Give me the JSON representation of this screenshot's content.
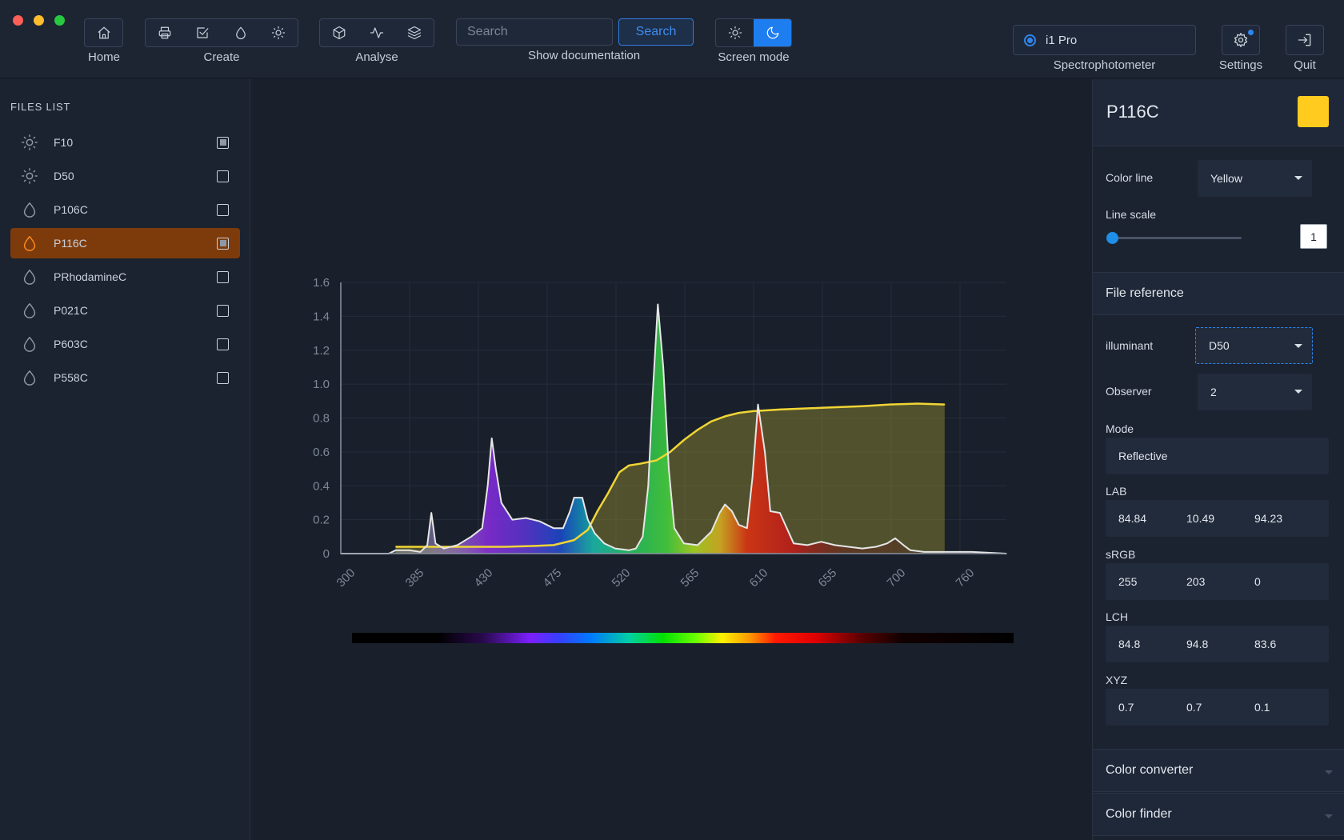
{
  "toolbar": {
    "home_label": "Home",
    "create_label": "Create",
    "analyse_label": "Analyse",
    "search_placeholder": "Search",
    "search_button": "Search",
    "docs_label": "Show documentation",
    "screen_mode_label": "Screen mode",
    "screen_mode_active": "dark",
    "spectro_device": "i1 Pro",
    "spectro_label": "Spectrophotometer",
    "settings_label": "Settings",
    "quit_label": "Quit"
  },
  "files": {
    "title": "FILES LIST",
    "items": [
      {
        "label": "F10",
        "icon": "illuminant-sun-icon",
        "checked": true,
        "selected": false
      },
      {
        "label": "D50",
        "icon": "illuminant-sun-icon",
        "checked": false,
        "selected": false
      },
      {
        "label": "P106C",
        "icon": "color-drop-icon",
        "checked": false,
        "selected": false
      },
      {
        "label": "P116C",
        "icon": "color-drop-icon",
        "checked": true,
        "selected": true
      },
      {
        "label": "PRhodamineC",
        "icon": "color-drop-icon",
        "checked": false,
        "selected": false
      },
      {
        "label": "P021C",
        "icon": "color-drop-icon",
        "checked": false,
        "selected": false
      },
      {
        "label": "P603C",
        "icon": "color-drop-icon",
        "checked": false,
        "selected": false
      },
      {
        "label": "P558C",
        "icon": "color-drop-icon",
        "checked": false,
        "selected": false
      }
    ]
  },
  "panel": {
    "sample_name": "P116C",
    "swatch_color": "#ffcb1f",
    "color_line_label": "Color line",
    "color_line_value": "Yellow",
    "line_scale_label": "Line scale",
    "line_scale_value": "1",
    "file_reference_label": "File reference",
    "illuminant_label": "illuminant",
    "illuminant_value": "D50",
    "observer_label": "Observer",
    "observer_value": "2",
    "mode_label": "Mode",
    "mode_value": "Reflective",
    "lab_label": "LAB",
    "lab": [
      "84.84",
      "10.49",
      "94.23"
    ],
    "srgb_label": "sRGB",
    "srgb": [
      "255",
      "203",
      "0"
    ],
    "lch_label": "LCH",
    "lch": [
      "84.8",
      "94.8",
      "83.6"
    ],
    "xyz_label": "XYZ",
    "xyz": [
      "0.7",
      "0.7",
      "0.1"
    ],
    "color_converter_label": "Color converter",
    "color_finder_label": "Color finder"
  },
  "chart_data": {
    "type": "area",
    "xlim": [
      300,
      785
    ],
    "ylim": [
      0,
      1.6
    ],
    "x_ticks": [
      "300",
      "385",
      "430",
      "475",
      "520",
      "565",
      "610",
      "655",
      "700",
      "760"
    ],
    "y_ticks": [
      "0",
      "0.2",
      "0.4",
      "0.6",
      "0.8",
      "1.0",
      "1.2",
      "1.4",
      "1.6"
    ],
    "grid": true,
    "series": [
      {
        "color": "#f1d535",
        "points": [
          [
            340,
            0.04
          ],
          [
            380,
            0.04
          ],
          [
            420,
            0.04
          ],
          [
            440,
            0.045
          ],
          [
            455,
            0.05
          ],
          [
            470,
            0.08
          ],
          [
            480,
            0.14
          ],
          [
            487,
            0.25
          ],
          [
            495,
            0.36
          ],
          [
            503,
            0.48
          ],
          [
            510,
            0.52
          ],
          [
            518,
            0.53
          ],
          [
            530,
            0.55
          ],
          [
            540,
            0.6
          ],
          [
            550,
            0.67
          ],
          [
            560,
            0.73
          ],
          [
            570,
            0.78
          ],
          [
            580,
            0.81
          ],
          [
            590,
            0.83
          ],
          [
            600,
            0.84
          ],
          [
            620,
            0.85
          ],
          [
            650,
            0.86
          ],
          [
            680,
            0.87
          ],
          [
            700,
            0.88
          ],
          [
            720,
            0.885
          ],
          [
            740,
            0.88
          ]
        ]
      },
      {
        "color": "#e6e6e6",
        "points": [
          [
            300,
            0
          ],
          [
            335,
            0
          ],
          [
            340,
            0.02
          ],
          [
            350,
            0.02
          ],
          [
            358,
            0.01
          ],
          [
            363,
            0.05
          ],
          [
            366,
            0.24
          ],
          [
            369,
            0.06
          ],
          [
            375,
            0.03
          ],
          [
            385,
            0.05
          ],
          [
            395,
            0.1
          ],
          [
            403,
            0.15
          ],
          [
            407,
            0.4
          ],
          [
            410,
            0.68
          ],
          [
            413,
            0.5
          ],
          [
            417,
            0.3
          ],
          [
            425,
            0.2
          ],
          [
            435,
            0.21
          ],
          [
            445,
            0.19
          ],
          [
            455,
            0.15
          ],
          [
            462,
            0.15
          ],
          [
            467,
            0.25
          ],
          [
            470,
            0.33
          ],
          [
            476,
            0.33
          ],
          [
            480,
            0.2
          ],
          [
            485,
            0.12
          ],
          [
            492,
            0.06
          ],
          [
            500,
            0.03
          ],
          [
            510,
            0.02
          ],
          [
            515,
            0.03
          ],
          [
            520,
            0.1
          ],
          [
            524,
            0.4
          ],
          [
            527,
            0.9
          ],
          [
            531,
            1.47
          ],
          [
            535,
            1.1
          ],
          [
            539,
            0.5
          ],
          [
            543,
            0.15
          ],
          [
            550,
            0.06
          ],
          [
            560,
            0.05
          ],
          [
            570,
            0.13
          ],
          [
            576,
            0.24
          ],
          [
            580,
            0.29
          ],
          [
            585,
            0.25
          ],
          [
            590,
            0.17
          ],
          [
            596,
            0.15
          ],
          [
            600,
            0.45
          ],
          [
            604,
            0.88
          ],
          [
            609,
            0.6
          ],
          [
            613,
            0.25
          ],
          [
            620,
            0.24
          ],
          [
            625,
            0.15
          ],
          [
            630,
            0.06
          ],
          [
            640,
            0.05
          ],
          [
            650,
            0.07
          ],
          [
            660,
            0.05
          ],
          [
            670,
            0.04
          ],
          [
            680,
            0.03
          ],
          [
            690,
            0.04
          ],
          [
            698,
            0.06
          ],
          [
            704,
            0.09
          ],
          [
            710,
            0.05
          ],
          [
            715,
            0.02
          ],
          [
            725,
            0.01
          ],
          [
            760,
            0.01
          ],
          [
            785,
            0
          ]
        ]
      }
    ]
  }
}
